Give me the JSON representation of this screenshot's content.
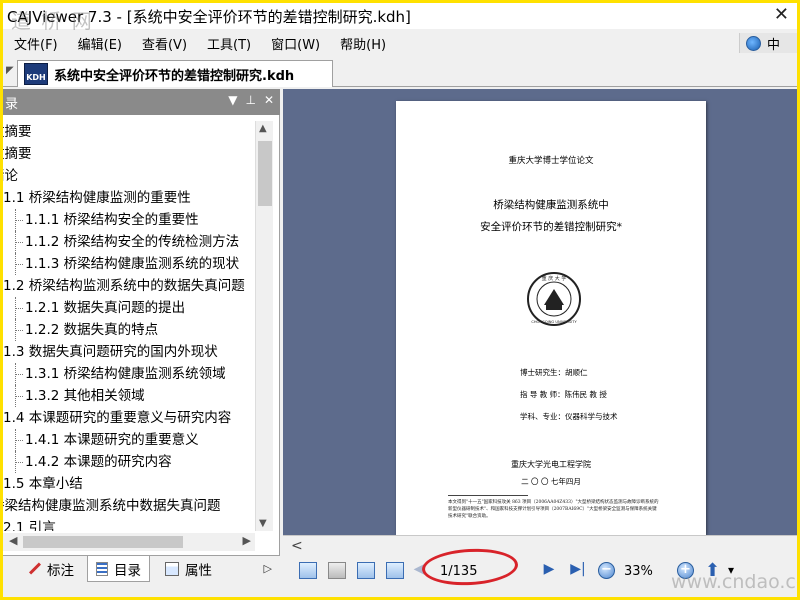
{
  "window": {
    "title": "CAJViewer 7.3 - [系统中安全评价环节的差错控制研究.kdh]",
    "close_glyph": "✕"
  },
  "watermarks": {
    "top_left": "道 桥 网",
    "bottom_right": "www.cndao.com"
  },
  "menubar": {
    "items": [
      "文件(F)",
      "编辑(E)",
      "查看(V)",
      "工具(T)",
      "窗口(W)",
      "帮助(H)"
    ],
    "right_label": "中"
  },
  "tabs": {
    "document": "系统中安全评价环节的差错控制研究.kdh",
    "kdh_icon_text": "KDH"
  },
  "panel": {
    "title": "录",
    "buttons": [
      "▼",
      "⊥",
      "✕"
    ]
  },
  "toc": [
    {
      "level": 0,
      "text": "文摘要"
    },
    {
      "level": 0,
      "text": "文摘要"
    },
    {
      "level": 0,
      "text": "绪论"
    },
    {
      "level": 1,
      "text": "1.1 桥梁结构健康监测的重要性"
    },
    {
      "level": 2,
      "text": "1.1.1 桥梁结构安全的重要性"
    },
    {
      "level": 2,
      "text": "1.1.2 桥梁结构安全的传统检测方法"
    },
    {
      "level": 2,
      "text": "1.1.3 桥梁结构健康监测系统的现状"
    },
    {
      "level": 1,
      "text": "1.2 桥梁结构监测系统中的数据失真问题"
    },
    {
      "level": 2,
      "text": "1.2.1 数据失真问题的提出"
    },
    {
      "level": 2,
      "text": "1.2.2 数据失真的特点"
    },
    {
      "level": 1,
      "text": "1.3 数据失真问题研究的国内外现状"
    },
    {
      "level": 2,
      "text": "1.3.1 桥梁结构健康监测系统领域"
    },
    {
      "level": 2,
      "text": "1.3.2 其他相关领域"
    },
    {
      "level": 1,
      "text": "1.4 本课题研究的重要意义与研究内容"
    },
    {
      "level": 2,
      "text": "1.4.1 本课题研究的重要意义"
    },
    {
      "level": 2,
      "text": "1.4.2 本课题的研究内容"
    },
    {
      "level": 1,
      "text": "1.5 本章小结"
    },
    {
      "level": 0,
      "text": "桥梁结构健康监测系统中数据失真问题"
    },
    {
      "level": 1,
      "text": "2.1 引言"
    }
  ],
  "bottom_tabs": [
    "标注",
    "目录",
    "属性"
  ],
  "bottom_tabs_more": "▷",
  "page": {
    "school": "重庆大学博士学位论文",
    "title_line1": "桥梁结构健康监测系统中",
    "title_line2": "安全评价环节的差错控制研究*",
    "emblem_top": "重 庆 大 学",
    "emblem_bottom": "CHONGQING UNIVERSITY",
    "info": [
      "博士研究生：胡顺仁",
      "指 导 教 师：陈伟民   教   授",
      "学科、专业：仪器科学与技术"
    ],
    "college": "重庆大学光电工程学院",
    "date": "二 〇 〇 七年四月",
    "footnote": "本文得到\"十一五\"国家科技攻关 863 项目（2006AA04Z433）\"大型桥梁结构状态监测与故障诊断系统的新型仪器研制技术\"、和国家科技支撑计划引导项目（2007BAI69C）\"大型桥梁安全监测与保障系统关键技术研究\"联合资助。"
  },
  "navbar": {
    "page_indicator": "1/135",
    "zoom": "33%",
    "prev_glyph": "◀",
    "next_glyph": "▶",
    "last_glyph": "▶|",
    "zoom_out": "−",
    "zoom_in": "+",
    "up_glyph": "⬆",
    "dropdown": "▾"
  },
  "colors": {
    "frame": "#ffe100",
    "doc_background": "#5d6b8c",
    "panel_header": "#8a8a8a",
    "annotation_ellipse": "#d8232a"
  }
}
